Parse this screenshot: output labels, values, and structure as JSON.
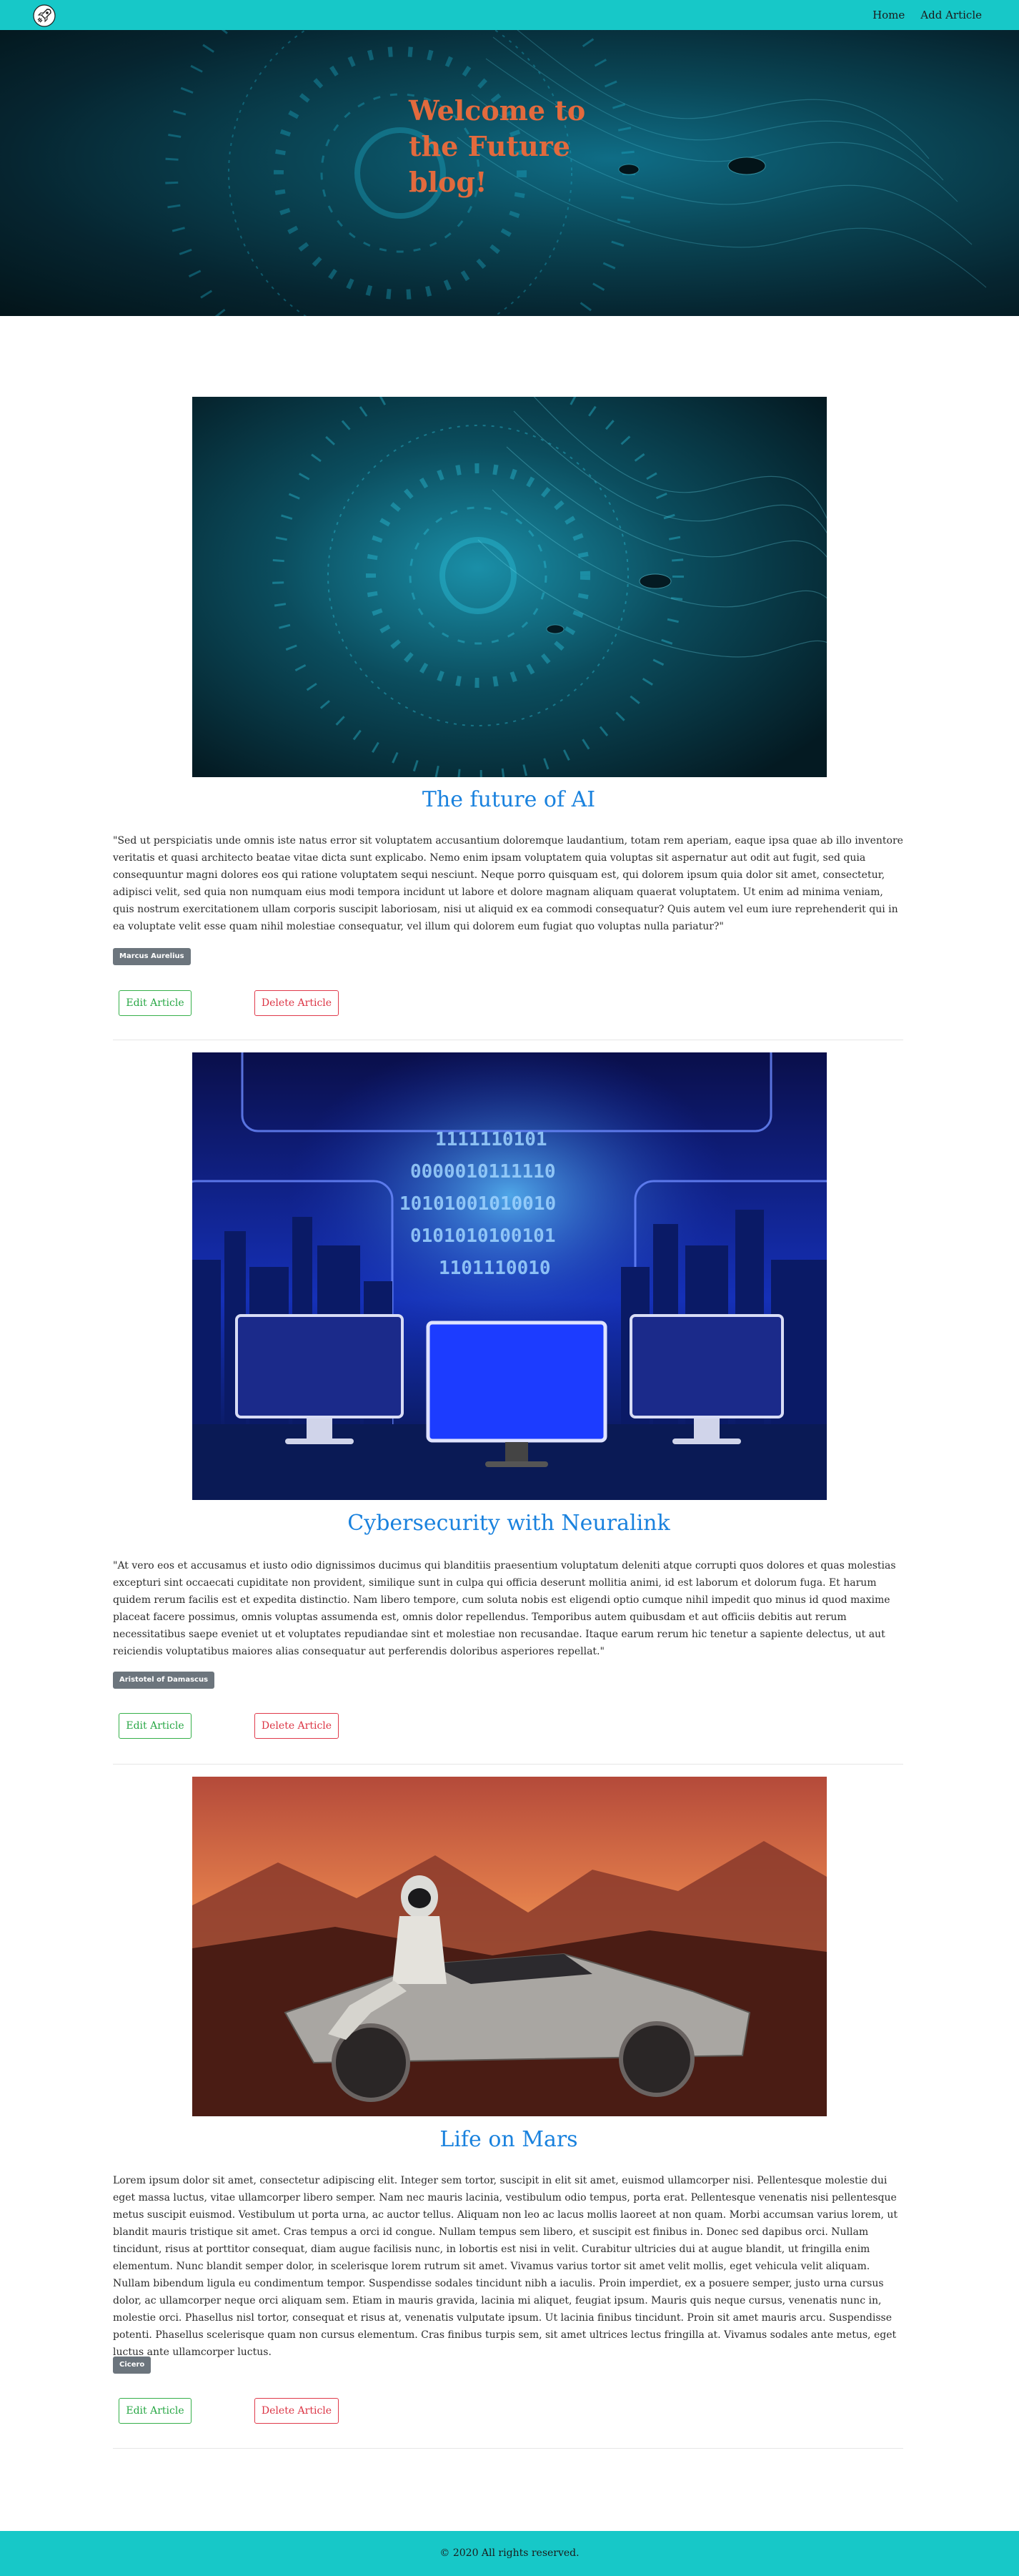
{
  "navbar": {
    "logo_icon": "rocket-icon",
    "links": [
      "Home",
      "Add Article"
    ]
  },
  "hero": {
    "title": "Welcome to the Future blog!"
  },
  "articles": [
    {
      "image_icon": "ai-face-image",
      "title": "The future of AI",
      "body": "\"Sed ut perspiciatis unde omnis iste natus error sit voluptatem accusantium doloremque laudantium, totam rem aperiam, eaque ipsa quae ab illo inventore veritatis et quasi architecto beatae vitae dicta sunt explicabo. Nemo enim ipsam voluptatem quia voluptas sit aspernatur aut odit aut fugit, sed quia consequuntur magni dolores eos qui ratione voluptatem sequi nesciunt. Neque porro quisquam est, qui dolorem ipsum quia dolor sit amet, consectetur, adipisci velit, sed quia non numquam eius modi tempora incidunt ut labore et dolore magnam aliquam quaerat voluptatem. Ut enim ad minima veniam, quis nostrum exercitationem ullam corporis suscipit laboriosam, nisi ut aliquid ex ea commodi consequatur? Quis autem vel eum iure reprehenderit qui in ea voluptate velit esse quam nihil molestiae consequatur, vel illum qui dolorem eum fugiat quo voluptas nulla pariatur?\"",
      "author": "Marcus Aurelius",
      "edit_label": "Edit Article",
      "delete_label": "Delete Article"
    },
    {
      "image_icon": "cyber-city-image",
      "title": "Cybersecurity with Neuralink",
      "body": "\"At vero eos et accusamus et iusto odio dignissimos ducimus qui blanditiis praesentium voluptatum deleniti atque corrupti quos dolores et quas molestias excepturi sint occaecati cupiditate non provident, similique sunt in culpa qui officia deserunt mollitia animi, id est laborum et dolorum fuga. Et harum quidem rerum facilis est et expedita distinctio. Nam libero tempore, cum soluta nobis est eligendi optio cumque nihil impedit quo minus id quod maxime placeat facere possimus, omnis voluptas assumenda est, omnis dolor repellendus. Temporibus autem quibusdam et aut officiis debitis aut rerum necessitatibus saepe eveniet ut et voluptates repudiandae sint et molestiae non recusandae. Itaque earum rerum hic tenetur a sapiente delectus, ut aut reiciendis voluptatibus maiores alias consequatur aut perferendis doloribus asperiores repellat.\"",
      "author": "Aristotel of Damascus",
      "edit_label": "Edit Article",
      "delete_label": "Delete Article"
    },
    {
      "image_icon": "mars-cybertruck-image",
      "title": "Life on Mars",
      "body": "Lorem ipsum dolor sit amet, consectetur adipiscing elit. Integer sem tortor, suscipit in elit sit amet, euismod ullamcorper nisi. Pellentesque molestie dui eget massa luctus, vitae ullamcorper libero semper. Nam nec mauris lacinia, vestibulum odio tempus, porta erat. Pellentesque venenatis nisi pellentesque metus suscipit euismod. Vestibulum ut porta urna, ac auctor tellus. Aliquam non leo ac lacus mollis laoreet at non quam. Morbi accumsan varius lorem, ut blandit mauris tristique sit amet. Cras tempus a orci id congue. Nullam tempus sem libero, et suscipit est finibus in. Donec sed dapibus orci. Nullam tincidunt, risus at porttitor consequat, diam augue facilisis nunc, in lobortis est nisi in velit.  Curabitur ultricies dui at augue blandit, ut fringilla enim elementum. Nunc blandit semper dolor, in scelerisque lorem rutrum sit amet. Vivamus varius tortor sit amet velit mollis, eget vehicula velit aliquam. Nullam bibendum ligula eu condimentum tempor. Suspendisse sodales tincidunt nibh a iaculis. Proin imperdiet, ex a posuere semper, justo urna cursus dolor, ac ullamcorper neque orci aliquam sem. Etiam in mauris gravida, lacinia mi aliquet, feugiat ipsum. Mauris quis neque cursus, venenatis nunc in, molestie orci. Phasellus nisl tortor, consequat et risus at, venenatis vulputate ipsum. Ut lacinia finibus tincidunt. Proin sit amet mauris arcu. Suspendisse potenti. Phasellus scelerisque quam non cursus elementum. Cras finibus turpis sem, sit amet ultrices lectus fringilla at. Vivamus sodales ante metus, eget luctus ante ullamcorper luctus.",
      "author": "Cicero",
      "edit_label": "Edit Article",
      "delete_label": "Delete Article"
    }
  ],
  "footer": {
    "text": "© 2020 All rights reserved."
  }
}
